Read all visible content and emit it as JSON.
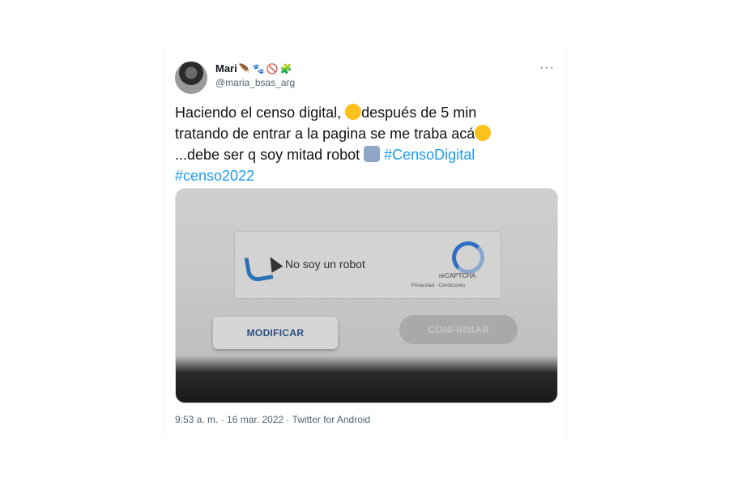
{
  "tweet": {
    "display_name": "Mari",
    "name_emojis": [
      "🪶",
      "🐾",
      "🚫",
      "🧩"
    ],
    "handle": "@maria_bsas_arg",
    "more_label": "···",
    "text_line1": "Haciendo el censo digital, ",
    "text_line1b": "después de 5 min",
    "text_line2": "tratando de entrar a la pagina se me traba acá",
    "text_line3": "...debe ser q soy mitad robot ",
    "hashtag1": "#CensoDigital",
    "hashtag2": "#censo2022",
    "timestamp": "9:53 a. m. · 16 mar. 2022 · Twitter for Android"
  },
  "media": {
    "captcha_label": "No soy un robot",
    "captcha_brand": "reCAPTCHA",
    "captcha_links": "Privacidad - Condiciones",
    "modify_button": "MODIFICAR",
    "confirm_button": "CONFIRMAR"
  },
  "colors": {
    "link": "#1d9bf0",
    "text": "#0f1419",
    "secondary": "#536471"
  }
}
